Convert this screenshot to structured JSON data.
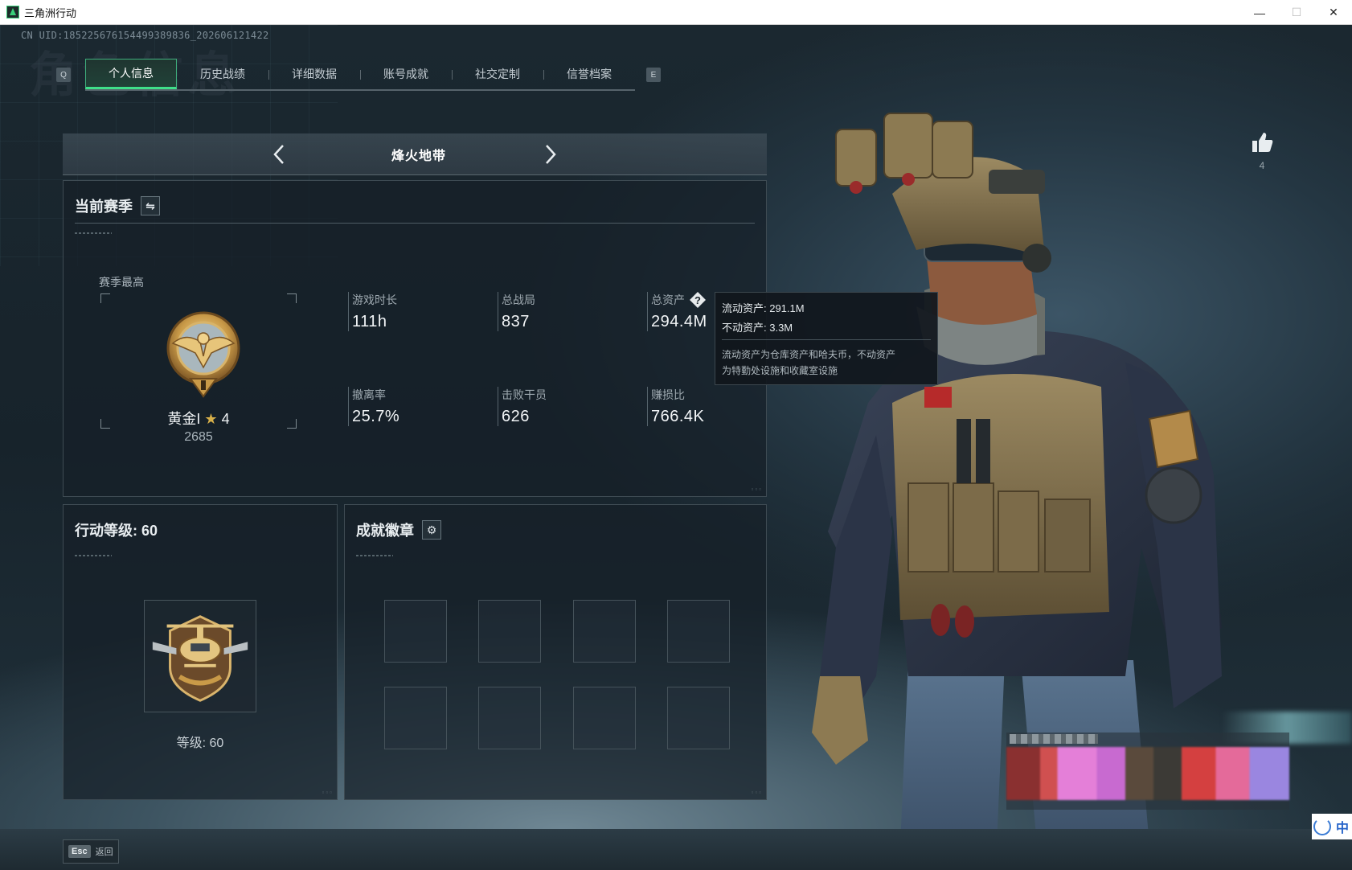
{
  "window": {
    "title": "三角洲行动",
    "minimize": "—",
    "maximize": "☐",
    "close": "✕"
  },
  "header": {
    "uid": "CN UID:185225676154499389836_202606121422",
    "ghost_heading": "角色信息",
    "left_key": "Q",
    "right_key": "E"
  },
  "tabs": [
    {
      "label": "个人信息",
      "active": true
    },
    {
      "label": "历史战绩",
      "active": false
    },
    {
      "label": "详细数据",
      "active": false
    },
    {
      "label": "账号成就",
      "active": false
    },
    {
      "label": "社交定制",
      "active": false
    },
    {
      "label": "信誉档案",
      "active": false
    }
  ],
  "mode": {
    "title": "烽火地带"
  },
  "season": {
    "title": "当前赛季",
    "best_label": "赛季最高",
    "rank_name": "黄金I",
    "rank_stars": "4",
    "rank_score": "2685",
    "stats": [
      {
        "label": "游戏时长",
        "value": "111h"
      },
      {
        "label": "总战局",
        "value": "837"
      },
      {
        "label": "总资产",
        "value": "294.4M"
      },
      {
        "label": "撤离率",
        "value": "25.7%"
      },
      {
        "label": "击败干员",
        "value": "626"
      },
      {
        "label": "赚损比",
        "value": "766.4K"
      }
    ]
  },
  "tooltip": {
    "liquid": "流动资产: 291.1M",
    "fixed": "不动资产: 3.3M",
    "note_line1": "流动资产为仓库资产和哈夫币，不动资产",
    "note_line2": "为特勤处设施和收藏室设施"
  },
  "level": {
    "title": "行动等级: 60",
    "text": "等级: 60"
  },
  "badges": {
    "title": "成就徽章",
    "slots": 8
  },
  "likes": {
    "count": "4"
  },
  "footer": {
    "esc_key": "Esc",
    "back_label": "返回"
  },
  "ime": {
    "lang": "中"
  },
  "colors": {
    "accent_green": "#3fe08a",
    "gold": "#d8b04a",
    "panel_bg": "#162028"
  }
}
